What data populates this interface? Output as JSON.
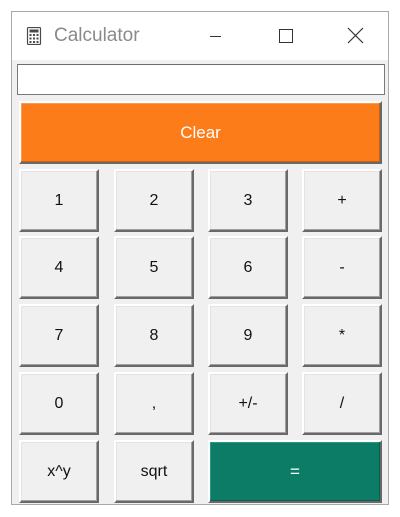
{
  "window": {
    "title": "Calculator",
    "icon": "calculator-icon"
  },
  "display": {
    "value": ""
  },
  "buttons": {
    "clear": "Clear",
    "row1": [
      "1",
      "2",
      "3",
      "+"
    ],
    "row2": [
      "4",
      "5",
      "6",
      "-"
    ],
    "row3": [
      "7",
      "8",
      "9",
      "*"
    ],
    "row4": [
      "0",
      ",",
      "+/-",
      "/"
    ],
    "row5": [
      "x^y",
      "sqrt"
    ],
    "equals": "="
  },
  "colors": {
    "clear_button": "#fd7c1a",
    "equals_button": "#0c7c66",
    "button_face": "#f0f0f0"
  }
}
